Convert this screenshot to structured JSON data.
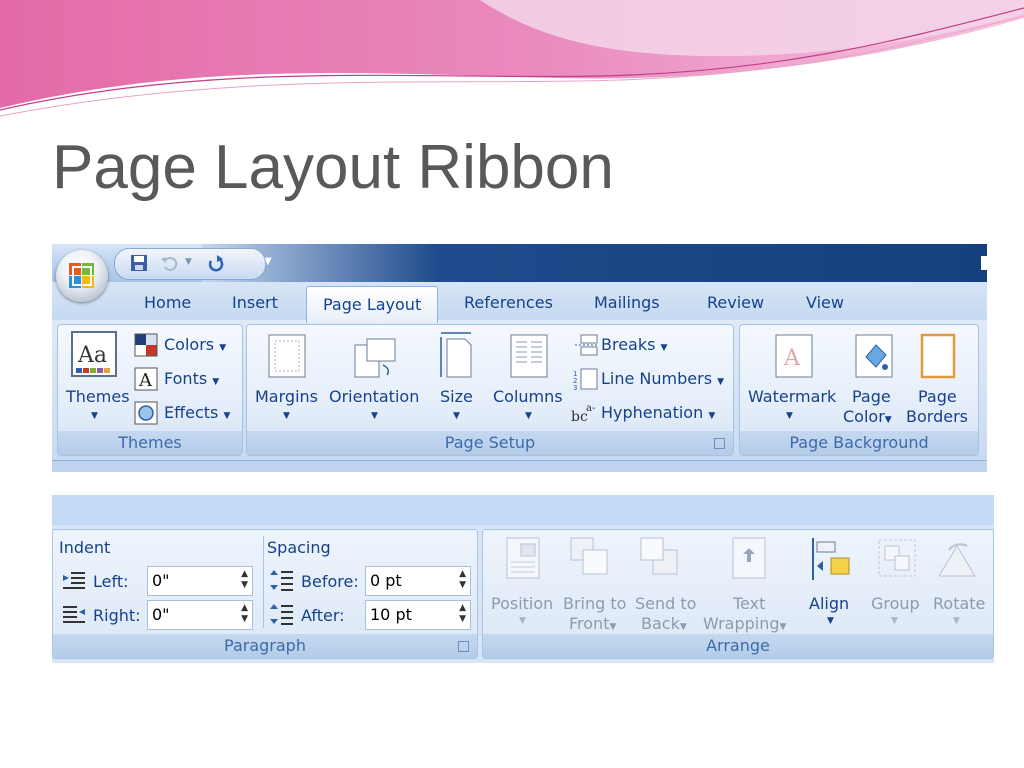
{
  "slide": {
    "title": "Page Layout Ribbon"
  },
  "ribbon": {
    "tabs": [
      "Home",
      "Insert",
      "Page Layout",
      "References",
      "Mailings",
      "Review",
      "View"
    ],
    "active_tab": "Page Layout",
    "groups": {
      "themes": {
        "label": "Themes",
        "themes_button": "Themes",
        "colors": "Colors",
        "fonts": "Fonts",
        "effects": "Effects"
      },
      "page_setup": {
        "label": "Page Setup",
        "margins": "Margins",
        "orientation": "Orientation",
        "size": "Size",
        "columns": "Columns",
        "breaks": "Breaks",
        "line_numbers": "Line Numbers",
        "hyphenation": "Hyphenation"
      },
      "page_background": {
        "label": "Page Background",
        "watermark": "Watermark",
        "page_color_1": "Page",
        "page_color_2": "Color",
        "page_borders_1": "Page",
        "page_borders_2": "Borders"
      }
    }
  },
  "paragraph": {
    "label": "Paragraph",
    "indent_heading": "Indent",
    "spacing_heading": "Spacing",
    "left_label": "Left:",
    "left_value": "0\"",
    "right_label": "Right:",
    "right_value": "0\"",
    "before_label": "Before:",
    "before_value": "0 pt",
    "after_label": "After:",
    "after_value": "10 pt"
  },
  "arrange": {
    "label": "Arrange",
    "position": "Position",
    "bring_to_front_1": "Bring to",
    "bring_to_front_2": "Front",
    "send_to_back_1": "Send to",
    "send_to_back_2": "Back",
    "text_wrapping_1": "Text",
    "text_wrapping_2": "Wrapping",
    "align": "Align",
    "group": "Group",
    "rotate": "Rotate"
  },
  "colors": {
    "ribbon_text": "#15428b",
    "title_text": "#595959",
    "disabled_text": "#8d9bb0",
    "banner_pink": "#e07bb5"
  }
}
